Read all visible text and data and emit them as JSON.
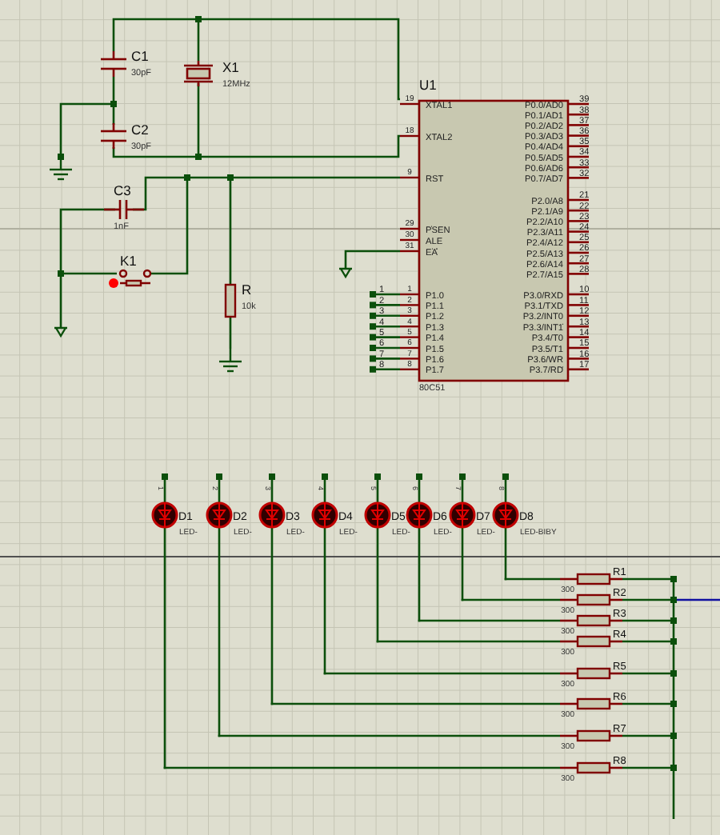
{
  "canvas": {
    "kind": "schematic"
  },
  "components": [
    {
      "kind": "capacitor",
      "ref": "C1",
      "value": "30pF"
    },
    {
      "kind": "capacitor",
      "ref": "C2",
      "value": "30pF"
    },
    {
      "kind": "crystal",
      "ref": "X1",
      "value": "12MHz"
    },
    {
      "kind": "capacitor_h",
      "ref": "C3",
      "value": "1nF"
    },
    {
      "kind": "switch",
      "ref": "K1"
    },
    {
      "kind": "resistor_v",
      "ref": "R",
      "value": "10k"
    }
  ],
  "chip": {
    "ref": "U1",
    "part": "80C51",
    "left_pins": [
      {
        "number": "19",
        "name": "XTAL1"
      },
      {
        "number": "18",
        "name": "XTAL2"
      },
      {
        "number": "9",
        "name": "RST"
      },
      {
        "number": "29",
        "bar": "PSEN"
      },
      {
        "number": "30",
        "name": "ALE"
      },
      {
        "number": "31",
        "bar": "EA"
      },
      {
        "number": "1",
        "name": "P1.0"
      },
      {
        "number": "2",
        "name": "P1.1"
      },
      {
        "number": "3",
        "name": "P1.2"
      },
      {
        "number": "4",
        "name": "P1.3"
      },
      {
        "number": "5",
        "name": "P1.4"
      },
      {
        "number": "6",
        "name": "P1.5"
      },
      {
        "number": "7",
        "name": "P1.6"
      },
      {
        "number": "8",
        "name": "P1.7"
      }
    ],
    "right_pins": [
      {
        "number": "39",
        "name": "P0.0/AD0"
      },
      {
        "number": "38",
        "name": "P0.1/AD1"
      },
      {
        "number": "37",
        "name": "P0.2/AD2"
      },
      {
        "number": "36",
        "name": "P0.3/AD3"
      },
      {
        "number": "35",
        "name": "P0.4/AD4"
      },
      {
        "number": "34",
        "name": "P0.5/AD5"
      },
      {
        "number": "33",
        "name": "P0.6/AD6"
      },
      {
        "number": "32",
        "name": "P0.7/AD7"
      },
      {
        "number": "21",
        "name": "P2.0/A8"
      },
      {
        "number": "22",
        "name": "P2.1/A9"
      },
      {
        "number": "23",
        "name": "P2.2/A10"
      },
      {
        "number": "24",
        "name": "P2.3/A11"
      },
      {
        "number": "25",
        "name": "P2.4/A12"
      },
      {
        "number": "26",
        "name": "P2.5/A13"
      },
      {
        "number": "27",
        "name": "P2.6/A14"
      },
      {
        "number": "28",
        "name": "P2.7/A15"
      },
      {
        "number": "10",
        "name": "P3.0/RXD"
      },
      {
        "number": "11",
        "name": "P3.1/TXD"
      },
      {
        "number": "12",
        "name": "P3.2/",
        "bar": "INT0"
      },
      {
        "number": "13",
        "name": "P3.3/",
        "bar": "INT1"
      },
      {
        "number": "14",
        "name": "P3.4/T0"
      },
      {
        "number": "15",
        "name": "P3.5/T1"
      },
      {
        "number": "16",
        "name": "P3.6/",
        "bar": "WR"
      },
      {
        "number": "17",
        "name": "P3.7/",
        "bar": "RD"
      }
    ]
  },
  "port1_net_labels": [
    "1",
    "2",
    "3",
    "4",
    "5",
    "6",
    "7",
    "8"
  ],
  "leds": [
    {
      "ref": "D1",
      "value": "LED-",
      "net": "1"
    },
    {
      "ref": "D2",
      "value": "LED-",
      "net": "2"
    },
    {
      "ref": "D3",
      "value": "LED-",
      "net": "3"
    },
    {
      "ref": "D4",
      "value": "LED-",
      "net": "4"
    },
    {
      "ref": "D5",
      "value": "LED-",
      "net": "5"
    },
    {
      "ref": "D6",
      "value": "LED-",
      "net": "6"
    },
    {
      "ref": "D7",
      "value": "LED-",
      "net": "7"
    },
    {
      "ref": "D8",
      "value": "LED-BIBY",
      "net": "8"
    }
  ],
  "resistors": [
    {
      "ref": "R1",
      "value": "300"
    },
    {
      "ref": "R2",
      "value": "300"
    },
    {
      "ref": "R3",
      "value": "300"
    },
    {
      "ref": "R4",
      "value": "300"
    },
    {
      "ref": "R5",
      "value": "300"
    },
    {
      "ref": "R6",
      "value": "300"
    },
    {
      "ref": "R7",
      "value": "300"
    },
    {
      "ref": "R8",
      "value": "300"
    }
  ]
}
